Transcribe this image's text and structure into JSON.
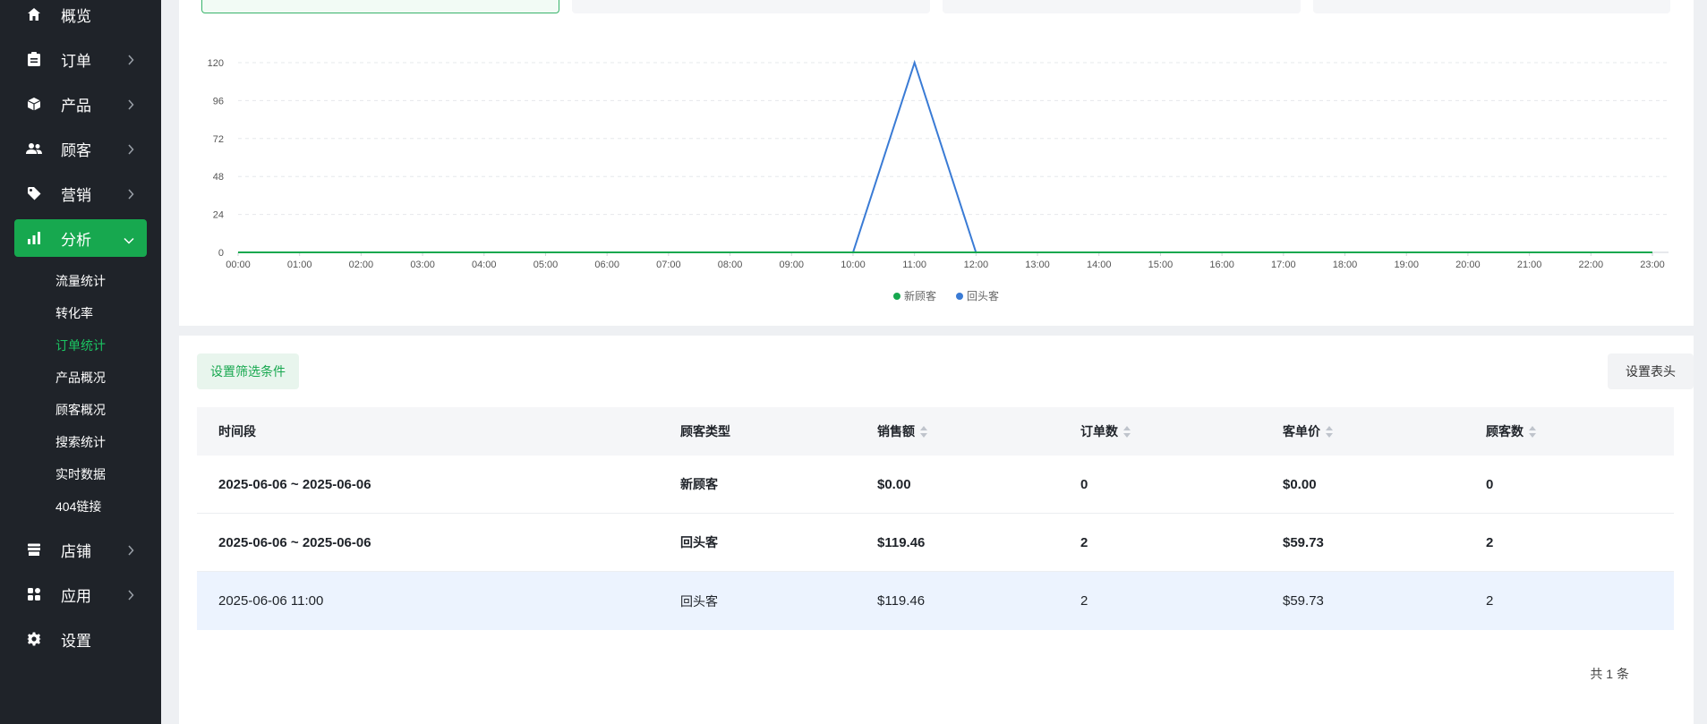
{
  "sidebar": {
    "items": [
      {
        "label": "概览",
        "icon": "home-icon",
        "has_children": false
      },
      {
        "label": "订单",
        "icon": "clipboard-icon",
        "has_children": true
      },
      {
        "label": "产品",
        "icon": "box-icon",
        "has_children": true
      },
      {
        "label": "顾客",
        "icon": "users-icon",
        "has_children": true
      },
      {
        "label": "营销",
        "icon": "tag-icon",
        "has_children": true
      },
      {
        "label": "分析",
        "icon": "bar-chart-icon",
        "has_children": true,
        "expanded": true
      },
      {
        "label": "店铺",
        "icon": "store-icon",
        "has_children": true
      },
      {
        "label": "应用",
        "icon": "apps-icon",
        "has_children": true
      },
      {
        "label": "设置",
        "icon": "gear-icon",
        "has_children": false
      }
    ],
    "analysis_sub": [
      "流量统计",
      "转化率",
      "订单统计",
      "产品概况",
      "顾客概况",
      "搜索统计",
      "实时数据",
      "404链接"
    ],
    "active_sub": "订单统计"
  },
  "chart_data": {
    "type": "line",
    "x": [
      "00:00",
      "01:00",
      "02:00",
      "03:00",
      "04:00",
      "05:00",
      "06:00",
      "07:00",
      "08:00",
      "09:00",
      "10:00",
      "11:00",
      "12:00",
      "13:00",
      "14:00",
      "15:00",
      "16:00",
      "17:00",
      "18:00",
      "19:00",
      "20:00",
      "21:00",
      "22:00",
      "23:00"
    ],
    "series": [
      {
        "name": "新顾客",
        "color": "#17a84f",
        "values": [
          0,
          0,
          0,
          0,
          0,
          0,
          0,
          0,
          0,
          0,
          0,
          0,
          0,
          0,
          0,
          0,
          0,
          0,
          0,
          0,
          0,
          0,
          0,
          0
        ]
      },
      {
        "name": "回头客",
        "color": "#3a7bd5",
        "values": [
          0,
          0,
          0,
          0,
          0,
          0,
          0,
          0,
          0,
          0,
          0,
          120,
          0,
          0,
          0,
          0,
          0,
          0,
          0,
          0,
          0,
          0,
          0,
          0
        ]
      }
    ],
    "yticks": [
      0,
      24,
      48,
      72,
      96,
      120
    ],
    "ylim": [
      0,
      120
    ],
    "grid": true,
    "legend": "bottom-center"
  },
  "table": {
    "filter_button": "设置筛选条件",
    "header_button": "设置表头",
    "columns": [
      {
        "label": "时间段",
        "sortable": false
      },
      {
        "label": "顾客类型",
        "sortable": false
      },
      {
        "label": "销售额",
        "sortable": true
      },
      {
        "label": "订单数",
        "sortable": true
      },
      {
        "label": "客单价",
        "sortable": true
      },
      {
        "label": "顾客数",
        "sortable": true
      }
    ],
    "rows": [
      {
        "cells": [
          "2025-06-06 ~ 2025-06-06",
          "新顾客",
          "$0.00",
          "0",
          "$0.00",
          "0"
        ],
        "style": "bold"
      },
      {
        "cells": [
          "2025-06-06 ~ 2025-06-06",
          "回头客",
          "$119.46",
          "2",
          "$59.73",
          "2"
        ],
        "style": "bold"
      },
      {
        "cells": [
          "2025-06-06 11:00",
          "回头客",
          "$119.46",
          "2",
          "$59.73",
          "2"
        ],
        "style": "highlight"
      }
    ],
    "total": "共 1 条"
  },
  "colors": {
    "accent": "#17a84f",
    "sidebar_bg": "#1f2329",
    "line_blue": "#3a7bd5"
  }
}
